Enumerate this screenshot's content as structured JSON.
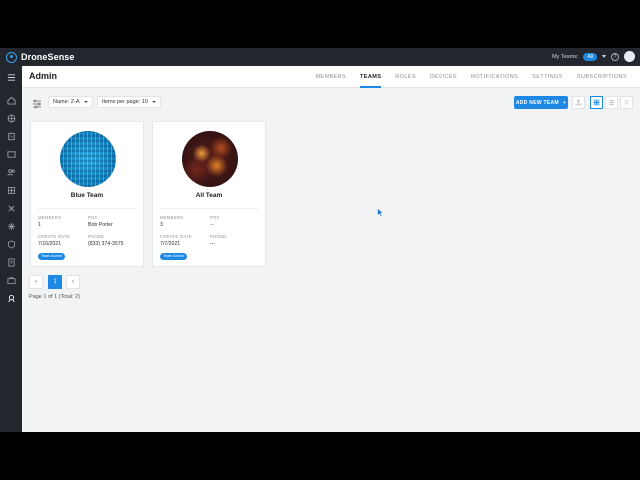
{
  "app": {
    "name": "DroneSense"
  },
  "topbar": {
    "my_teams_label": "My Teams:",
    "my_teams_value": "All",
    "help_icon": "help-icon"
  },
  "nav_icons": [
    "menu-icon",
    "home-icon",
    "globe-icon",
    "map-icon",
    "media-icon",
    "people-icon",
    "grid-icon",
    "drone-icon",
    "settings-icon",
    "shield-icon",
    "checklist-icon",
    "briefcase-icon",
    "admin-icon"
  ],
  "header": {
    "title": "Admin",
    "tabs": [
      "MEMBERS",
      "TEAMS",
      "ROLES",
      "DEVICES",
      "NOTIFICATIONS",
      "SETTINGS",
      "SUBSCRIPTIONS"
    ],
    "active_tab": "TEAMS"
  },
  "toolbar": {
    "sort_value": "Name: Z-A",
    "per_page_value": "Items per page: 10",
    "add_button": "ADD NEW TEAM",
    "add_button_icon": "+"
  },
  "labels": {
    "members": "MEMBERS",
    "poc": "POC",
    "create_date": "CREATE DATE",
    "phone": "PHONE"
  },
  "teams": [
    {
      "name": "Blue Team",
      "members": "1",
      "poc": "Bob Porter",
      "create_date": "7/16/2021",
      "phone": "(833) 374-3575",
      "badge": "Team Admin"
    },
    {
      "name": "All Team",
      "members": "3",
      "poc": "--",
      "create_date": "7/7/2021",
      "phone": "---",
      "badge": "Team Admin"
    }
  ],
  "pagination": {
    "prev": "‹",
    "current": "1",
    "next": "›",
    "info": "Page 1 of 1  (Total: 2)"
  },
  "colors": {
    "accent": "#1e88e5",
    "nav_bg": "#23272d",
    "page_bg": "#f2f3f5"
  }
}
